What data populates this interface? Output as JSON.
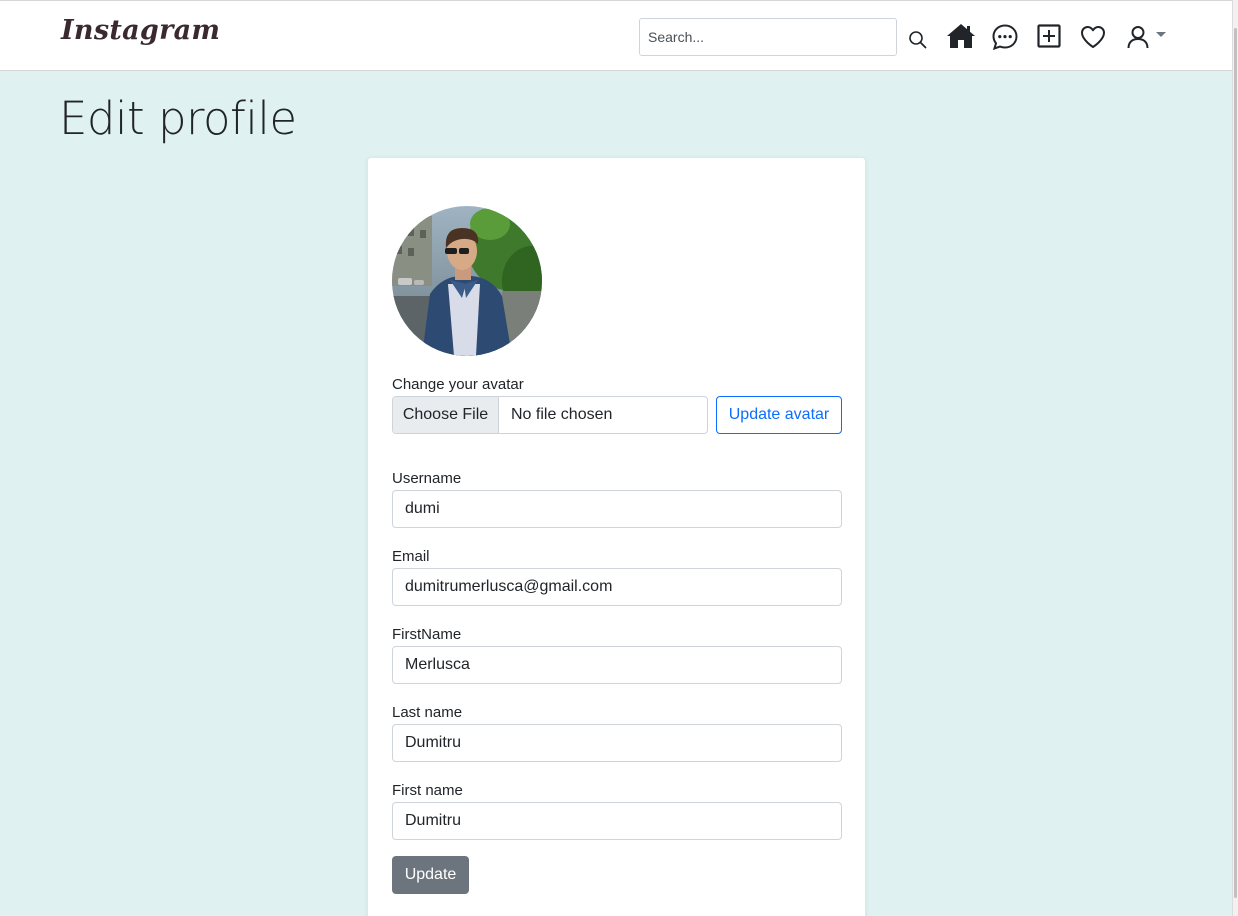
{
  "navbar": {
    "brand": "Instagram",
    "search_placeholder": "Search...",
    "icons": [
      "search-icon",
      "home-icon",
      "messages-icon",
      "add-post-icon",
      "heart-icon",
      "user-icon",
      "caret-down-icon"
    ]
  },
  "page": {
    "title": "Edit profile"
  },
  "form": {
    "avatar_label": "Change your avatar",
    "choose_file_label": "Choose File",
    "file_status": "No file chosen",
    "update_avatar_label": "Update avatar",
    "fields": [
      {
        "label": "Username",
        "value": "dumi"
      },
      {
        "label": "Email",
        "value": "dumitrumerlusca@gmail.com"
      },
      {
        "label": "FirstName",
        "value": "Merlusca"
      },
      {
        "label": "Last name",
        "value": "Dumitru"
      },
      {
        "label": "First name",
        "value": "Dumitru"
      }
    ],
    "submit_label": "Update"
  },
  "colors": {
    "page_background": "#dff2f1",
    "primary": "#0d6efd",
    "secondary_button": "#6c757d",
    "brand_text": "#3a2a30"
  }
}
